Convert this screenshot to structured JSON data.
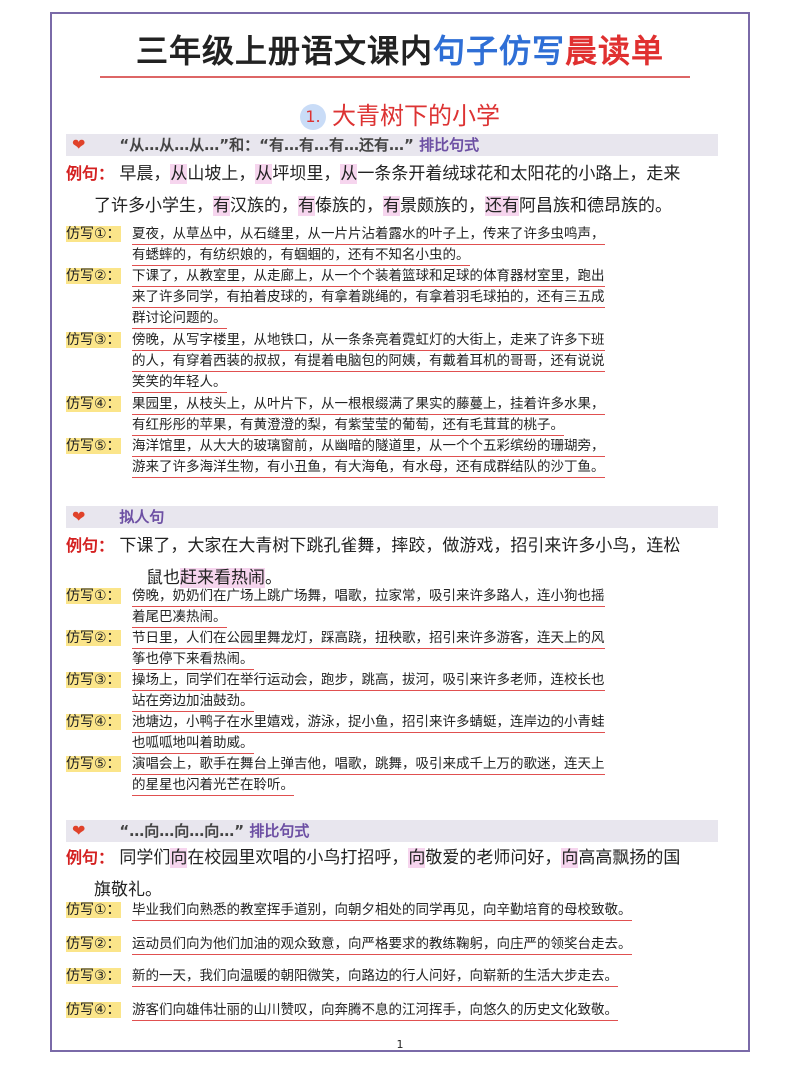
{
  "title": {
    "part1": "三年级上册语文课内",
    "part2": "句子仿写",
    "part3": "晨读单"
  },
  "lesson": {
    "num": "1.",
    "name": "大青树下的小学"
  },
  "sections": [
    {
      "heading_a": "“从…从…从…”和：“有…有…有…还有…”",
      "heading_b": "排比句式",
      "example_label": "例句：",
      "example_lines": [
        "早晨，从山坡上，从坪坝里，从一条条开着绒球花和太阳花的小路上，走来",
        "了许多小学生，有汉族的，有傣族的，有景颇族的，还有阿昌族和德昂族的。"
      ],
      "items": [
        {
          "tag": "仿写①：",
          "lines": [
            "夏夜，从草丛中，从石缝里，从一片片沾着露水的叶子上，传来了许多虫鸣声，",
            "有蟋蟀的，有纺织娘的，有蝈蝈的，还有不知名小虫的。"
          ]
        },
        {
          "tag": "仿写②：",
          "lines": [
            "下课了，从教室里，从走廊上，从一个个装着篮球和足球的体育器材室里，跑出",
            "来了许多同学，有拍着皮球的，有拿着跳绳的，有拿着羽毛球拍的，还有三五成",
            "群讨论问题的。"
          ]
        },
        {
          "tag": "仿写③：",
          "lines": [
            "傍晚，从写字楼里，从地铁口，从一条条亮着霓虹灯的大街上，走来了许多下班",
            "的人，有穿着西装的叔叔，有提着电脑包的阿姨，有戴着耳机的哥哥，还有说说",
            "笑笑的年轻人。"
          ]
        },
        {
          "tag": "仿写④：",
          "lines": [
            "果园里，从枝头上，从叶片下，从一根根缀满了果实的藤蔓上，挂着许多水果，",
            "有红彤彤的苹果，有黄澄澄的梨，有紫莹莹的葡萄，还有毛茸茸的桃子。"
          ]
        },
        {
          "tag": "仿写⑤：",
          "lines": [
            "海洋馆里，从大大的玻璃窗前，从幽暗的隧道里，从一个个五彩缤纷的珊瑚旁，",
            "游来了许多海洋生物，有小丑鱼，有大海龟，有水母，还有成群结队的沙丁鱼。"
          ]
        }
      ]
    },
    {
      "heading_a": "拟人句",
      "heading_b": "",
      "example_label": "例句：",
      "example_lines": [
        "下课了，大家在大青树下跳孔雀舞，摔跤，做游戏，招引来许多小鸟，连松",
        "鼠也赶来看热闹。"
      ],
      "items": [
        {
          "tag": "仿写①：",
          "lines": [
            "傍晚，奶奶们在广场上跳广场舞，唱歌，拉家常，吸引来许多路人，连小狗也摇",
            "着尾巴凑热闹。"
          ]
        },
        {
          "tag": "仿写②：",
          "lines": [
            "节日里，人们在公园里舞龙灯，踩高跷，扭秧歌，招引来许多游客，连天上的风",
            "筝也停下来看热闹。"
          ]
        },
        {
          "tag": "仿写③：",
          "lines": [
            "操场上，同学们在举行运动会，跑步，跳高，拔河，吸引来许多老师，连校长也",
            "站在旁边加油鼓劲。"
          ]
        },
        {
          "tag": "仿写④：",
          "lines": [
            "池塘边，小鸭子在水里嬉戏，游泳，捉小鱼，招引来许多蜻蜓，连岸边的小青蛙",
            "也呱呱地叫着助威。"
          ]
        },
        {
          "tag": "仿写⑤：",
          "lines": [
            "演唱会上，歌手在舞台上弹吉他，唱歌，跳舞，吸引来成千上万的歌迷，连天上",
            "的星星也闪着光芒在聆听。"
          ]
        }
      ]
    },
    {
      "heading_a": "“…向…向…向…”",
      "heading_b": "排比句式",
      "example_label": "例句：",
      "example_lines": [
        "同学们向在校园里欢唱的小鸟打招呼，向敬爱的老师问好，向高高飘扬的国",
        "旗敬礼。"
      ],
      "items": [
        {
          "tag": "仿写①：",
          "lines": [
            "毕业我们向熟悉的教室挥手道别，向朝夕相处的同学再见，向辛勤培育的母校致敬。"
          ]
        },
        {
          "tag": "仿写②：",
          "lines": [
            "运动员们向为他们加油的观众致意，向严格要求的教练鞠躬，向庄严的领奖台走去。"
          ]
        },
        {
          "tag": "仿写③：",
          "lines": [
            "新的一天，我们向温暖的朝阳微笑，向路边的行人问好，向崭新的生活大步走去。"
          ]
        },
        {
          "tag": "仿写④：",
          "lines": [
            "游客们向雄伟壮丽的山川赞叹，向奔腾不息的江河挥手，向悠久的历史文化致敬。"
          ]
        }
      ]
    }
  ],
  "page_number": "1"
}
